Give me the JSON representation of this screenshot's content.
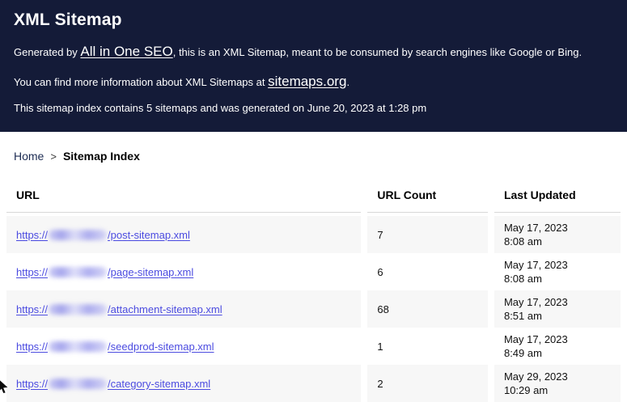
{
  "hero": {
    "title": "XML Sitemap",
    "bg_color": "#141b38",
    "text_color": "#ffffff",
    "intro": {
      "prefix": "Generated by ",
      "link": "All in One SEO",
      "suffix": ", this is an XML Sitemap, meant to be consumed by search engines like Google or Bing."
    },
    "info": {
      "prefix": "You can find more information about XML Sitemaps at ",
      "link": "sitemaps.org",
      "suffix": "."
    },
    "summary": "This sitemap index contains 5 sitemaps and was generated on June 20, 2023 at 1:28 pm"
  },
  "breadcrumb": {
    "home": "Home",
    "separator": ">",
    "current": "Sitemap Index"
  },
  "table": {
    "headers": [
      "URL",
      "URL Count",
      "Last Updated"
    ],
    "link_color": "#4b4be0",
    "stripe_color": "#f7f7f7",
    "url_scheme": "https://",
    "rows": [
      {
        "path": "/post-sitemap.xml",
        "count": "7",
        "date": "May 17, 2023",
        "time": "8:08 am"
      },
      {
        "path": "/page-sitemap.xml",
        "count": "6",
        "date": "May 17, 2023",
        "time": "8:08 am"
      },
      {
        "path": "/attachment-sitemap.xml",
        "count": "68",
        "date": "May 17, 2023",
        "time": "8:51 am"
      },
      {
        "path": "/seedprod-sitemap.xml",
        "count": "1",
        "date": "May 17, 2023",
        "time": "8:49 am"
      },
      {
        "path": "/category-sitemap.xml",
        "count": "2",
        "date": "May 29, 2023",
        "time": "10:29 am"
      }
    ]
  }
}
